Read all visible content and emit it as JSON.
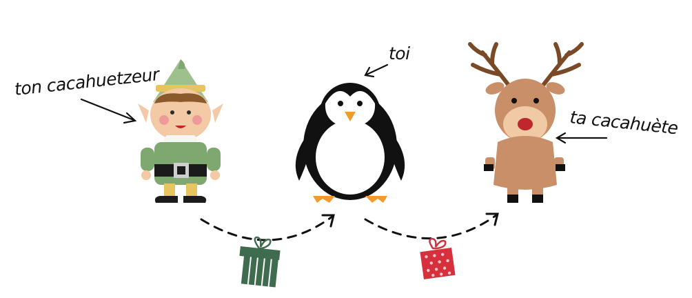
{
  "labels": {
    "giver": "ton cacahuetzeur",
    "you": "toi",
    "receiver": "ta cacahuète"
  },
  "characters": [
    {
      "name": "elf-icon"
    },
    {
      "name": "penguin-icon"
    },
    {
      "name": "reindeer-icon"
    }
  ],
  "gifts": [
    {
      "name": "gift-icon",
      "color": "#3f6b4f",
      "ribbon": "#ffffff"
    },
    {
      "name": "gift-icon",
      "color": "#d6303d",
      "ribbon": "#f4c7cc"
    }
  ],
  "colors": {
    "elf_green": "#7ea86f",
    "elf_hat": "#9ec08c",
    "hat_band": "#e8c45f",
    "elf_skin": "#f3c9a6",
    "penguin_black": "#111111",
    "penguin_beak": "#f39a2c",
    "reindeer_brown": "#c98f68",
    "reindeer_face": "#f0c9a5",
    "antler": "#7a4a26",
    "nose": "#c0272d",
    "arrow": "#111111"
  }
}
